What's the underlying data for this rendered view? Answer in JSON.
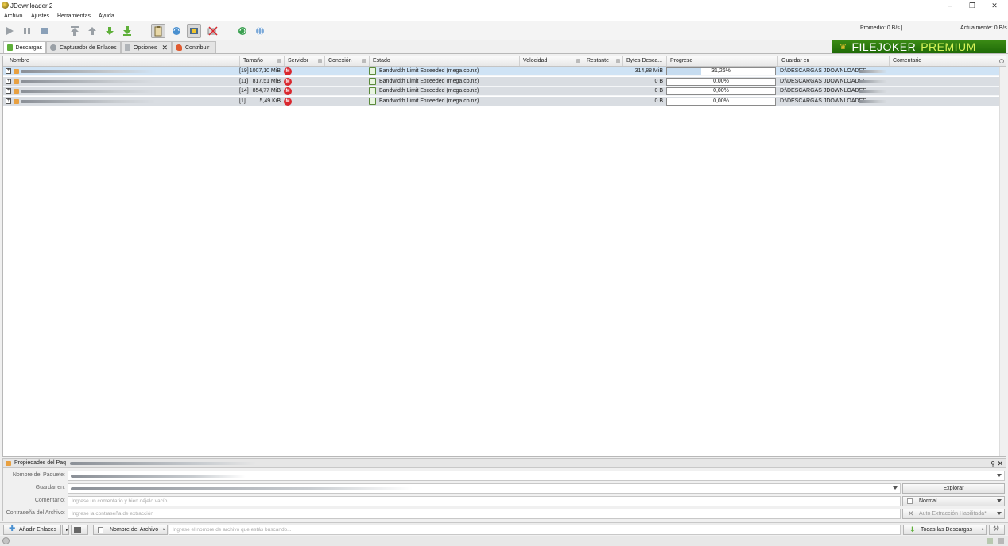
{
  "window": {
    "title": "JDownloader 2",
    "minimize": "–",
    "restore": "❐",
    "close": "✕"
  },
  "menu": [
    "Archivo",
    "Ajustes",
    "Herramientas",
    "Ayuda"
  ],
  "speed": {
    "average": "Promedio: 0 B/s |",
    "current": "Actualmente: 0 B/s"
  },
  "tabs": [
    {
      "label": "Descargas",
      "icon": "download-arrow-icon"
    },
    {
      "label": "Capturador de Enlaces",
      "icon": "linkgrabber-icon"
    },
    {
      "label": "Opciones",
      "icon": "tools-icon",
      "close": "✕"
    },
    {
      "label": "Contribuir",
      "icon": "heart-icon"
    }
  ],
  "banner": {
    "brand": "FILEJOKER",
    "tier": "PREMIUM",
    "crown": "♛"
  },
  "columns": [
    "Nombre",
    "Tamaño",
    "Servidor",
    "Conexión",
    "Estado",
    "Velocidad",
    "Restante",
    "Bytes Desca...",
    "Progreso",
    "Guardar en",
    "Comentario"
  ],
  "rows": [
    {
      "count": "[19]",
      "size": "1007,10 MiB",
      "host": "M",
      "status": "Bandwidth Limit Exceeded (mega.co.nz)",
      "bytes": "314,88 MiB",
      "progress_text": "31,26%",
      "progress": 0.3126,
      "save_to": "D:\\DESCARGAS JDOWNLOADER"
    },
    {
      "count": "[11]",
      "size": "817,51 MiB",
      "host": "M",
      "status": "Bandwidth Limit Exceeded (mega.co.nz)",
      "bytes": "0 B",
      "progress_text": "0,00%",
      "progress": 0.0,
      "save_to": "D:\\DESCARGAS JDOWNLOADER"
    },
    {
      "count": "[14]",
      "size": "854,77 MiB",
      "host": "M",
      "status": "Bandwidth Limit Exceeded (mega.co.nz)",
      "bytes": "0 B",
      "progress_text": "0,00%",
      "progress": 0.0,
      "save_to": "D:\\DESCARGAS JDOWNLOADER"
    },
    {
      "count": "[1]",
      "size": "5,49 KiB",
      "host": "M",
      "status": "Bandwidth Limit Exceeded (mega.co.nz)",
      "bytes": "0 B",
      "progress_text": "0,00%",
      "progress": 0.0,
      "save_to": "D:\\DESCARGAS JDOWNLOADER"
    }
  ],
  "properties": {
    "title": "Propiedades del Paq",
    "package_name_label": "Nombre del Paquete:",
    "save_in_label": "Guardar en:",
    "comment_label": "Comentario:",
    "comment_placeholder": "Ingrese un comentario y bien déjelo vacío...",
    "password_label": "Contraseña del Archivo:",
    "password_placeholder": "Ingrese la contraseña de extracción",
    "explore_button": "Explorar",
    "priority": "Normal",
    "auto_extract": "Auto Extracción Habilitada*"
  },
  "bottom": {
    "add_links": "Añadir Enlaces",
    "filter_field": "Nombre del Archivo",
    "search_placeholder": "Ingrese el nombre de archivo que estás buscando...",
    "view": "Todas las Descargas"
  },
  "colors": {
    "accent": "#cfe3f5",
    "banner_green": "#2f7e10",
    "mega_red": "#d9272e"
  }
}
